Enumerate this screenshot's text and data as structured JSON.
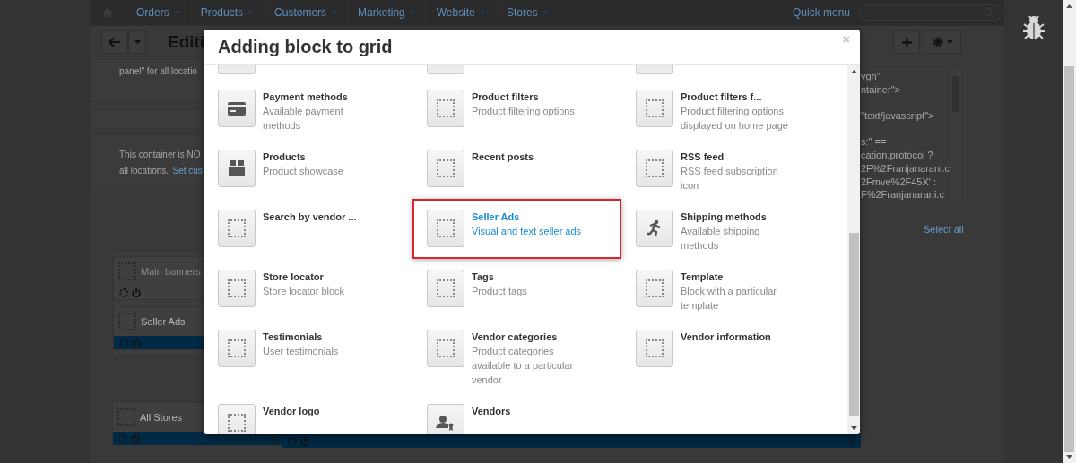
{
  "nav": {
    "items": [
      {
        "label": "Orders"
      },
      {
        "label": "Products"
      },
      {
        "label": "Customers"
      },
      {
        "label": "Marketing"
      },
      {
        "label": "Website"
      },
      {
        "label": "Stores"
      }
    ],
    "quick_menu": "Quick menu"
  },
  "toolbar": {
    "title": "Editi"
  },
  "left_panel": {
    "note": "panel\" for all locatio",
    "container_text": "This container is NO",
    "container_text_2": "all locations.",
    "link": "Set cus"
  },
  "blocks": [
    {
      "name": "Main banners",
      "disabled": true
    },
    {
      "name": "Seller Ads",
      "disabled": false
    },
    {
      "name": "All Stores",
      "disabled": false
    }
  ],
  "code_blocks": [
    [
      "ygh\"",
      "ntainer\">"
    ],
    [
      "\"text/javascript\">"
    ],
    [
      "s:\" ==",
      "cation.protocol ?",
      "2F%2Franjanarani.c",
      "2Fmve%2F45X' :",
      "F%2Franjanarani.c"
    ]
  ],
  "select_all": "Select all",
  "modal": {
    "title": "Adding block to grid",
    "close": "×",
    "items": [
      {
        "title": "Payment methods",
        "description": "Available payment methods",
        "kind": "card",
        "selected": false
      },
      {
        "title": "Product filters",
        "description": "Product filtering options",
        "kind": "placeholder",
        "selected": false
      },
      {
        "title": "Product filters f...",
        "description": "Product filtering options, displayed on home page",
        "kind": "placeholder",
        "selected": false
      },
      {
        "title": "Products",
        "description": "Product showcase",
        "kind": "box",
        "selected": false
      },
      {
        "title": "Recent posts",
        "kind": "placeholder",
        "selected": false
      },
      {
        "title": "RSS feed",
        "description": "RSS feed subscription icon",
        "kind": "placeholder",
        "selected": false
      },
      {
        "title": "Search by vendor ...",
        "kind": "placeholder",
        "selected": false
      },
      {
        "title": "Seller Ads",
        "description": "Visual and text seller ads",
        "kind": "placeholder",
        "selected": true
      },
      {
        "title": "Shipping methods",
        "description": "Available shipping methods",
        "kind": "runner",
        "selected": false
      },
      {
        "title": "Store locator",
        "description": "Store locator block",
        "kind": "placeholder",
        "selected": false
      },
      {
        "title": "Tags",
        "description": "Product tags",
        "kind": "placeholder",
        "selected": false
      },
      {
        "title": "Template",
        "description": "Block with a particular template",
        "kind": "placeholder",
        "selected": false
      },
      {
        "title": "Testimonials",
        "description": "User testimonials",
        "kind": "placeholder",
        "selected": false
      },
      {
        "title": "Vendor categories",
        "description": "Product categories available to a particular vendor",
        "kind": "placeholder",
        "selected": false
      },
      {
        "title": "Vendor information",
        "kind": "placeholder",
        "selected": false
      },
      {
        "title": "Vendor logo",
        "kind": "placeholder",
        "selected": false
      },
      {
        "title": "Vendors",
        "kind": "vendor",
        "selected": false
      }
    ]
  }
}
